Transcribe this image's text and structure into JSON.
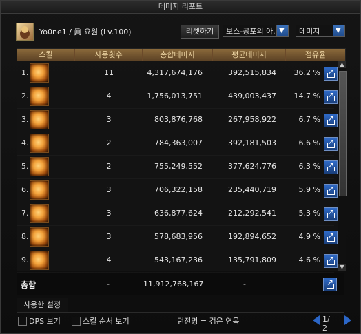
{
  "window": {
    "title": "데미지 리포트"
  },
  "header": {
    "player_name": "Yo0ne1 / 眞 요원 (Lv.100)",
    "reset_label": "리셋하기",
    "boss_select": "보스-공포의 아..",
    "metric_select": "데미지"
  },
  "table": {
    "columns": [
      "스킬",
      "사용횟수",
      "총합데미지",
      "평균데미지",
      "점유율"
    ],
    "rows": [
      {
        "rank": "1.",
        "usage": "11",
        "total": "4,317,674,176",
        "avg": "392,515,834",
        "share": "36.2 %"
      },
      {
        "rank": "2.",
        "usage": "4",
        "total": "1,756,013,751",
        "avg": "439,003,437",
        "share": "14.7 %"
      },
      {
        "rank": "3.",
        "usage": "3",
        "total": "803,876,768",
        "avg": "267,958,922",
        "share": "6.7 %"
      },
      {
        "rank": "4.",
        "usage": "2",
        "total": "784,363,007",
        "avg": "392,181,503",
        "share": "6.6 %"
      },
      {
        "rank": "5.",
        "usage": "2",
        "total": "755,249,552",
        "avg": "377,624,776",
        "share": "6.3 %"
      },
      {
        "rank": "6.",
        "usage": "3",
        "total": "706,322,158",
        "avg": "235,440,719",
        "share": "5.9 %"
      },
      {
        "rank": "7.",
        "usage": "3",
        "total": "636,877,624",
        "avg": "212,292,541",
        "share": "5.3 %"
      },
      {
        "rank": "8.",
        "usage": "3",
        "total": "578,683,956",
        "avg": "192,894,652",
        "share": "4.9 %"
      },
      {
        "rank": "9.",
        "usage": "4",
        "total": "543,167,236",
        "avg": "135,791,809",
        "share": "4.6 %"
      }
    ]
  },
  "totals": {
    "label": "총합",
    "usage": "-",
    "total": "11,912,768,167",
    "avg": "-"
  },
  "tabs": {
    "used_settings": "사용한 설정"
  },
  "footer": {
    "dps_label": "DPS 보기",
    "skill_order_label": "스킬 순서 보기",
    "mid_text": "던전명 = 검은 연옥",
    "page_text": "1/ 2"
  }
}
